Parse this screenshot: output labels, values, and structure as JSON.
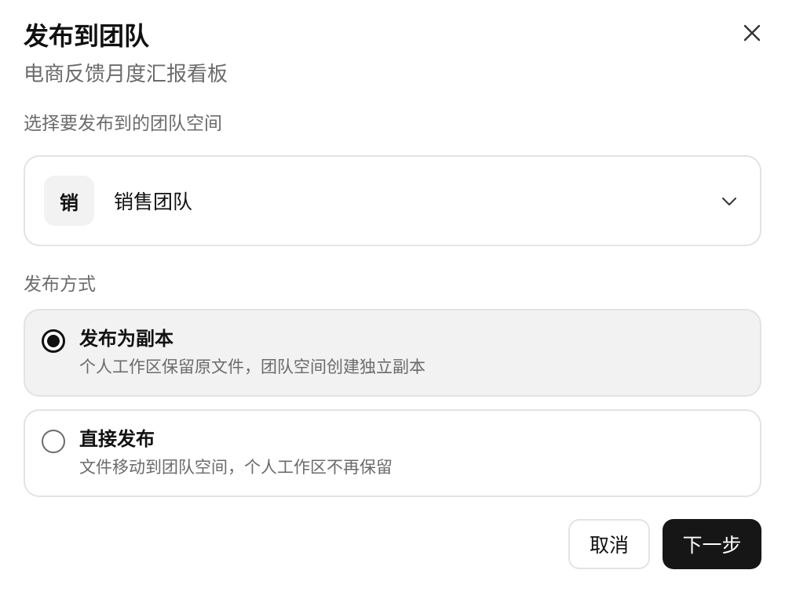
{
  "dialog": {
    "title": "发布到团队",
    "subtitle": "电商反馈月度汇报看板",
    "close_icon": "close-icon"
  },
  "team_section": {
    "label": "选择要发布到的团队空间",
    "selected_team": {
      "avatar_text": "销",
      "name": "销售团队"
    },
    "dropdown_icon": "chevron-down-icon"
  },
  "method_section": {
    "label": "发布方式",
    "options": [
      {
        "title": "发布为副本",
        "description": "个人工作区保留原文件，团队空间创建独立副本",
        "selected": true
      },
      {
        "title": "直接发布",
        "description": "文件移动到团队空间，个人工作区不再保留",
        "selected": false
      }
    ]
  },
  "footer": {
    "cancel_label": "取消",
    "next_label": "下一步"
  },
  "colors": {
    "primary_button": "#161616",
    "selected_option_bg": "#f2f2f2",
    "border": "#e3e3e3",
    "muted_text": "#6b6b6b"
  }
}
